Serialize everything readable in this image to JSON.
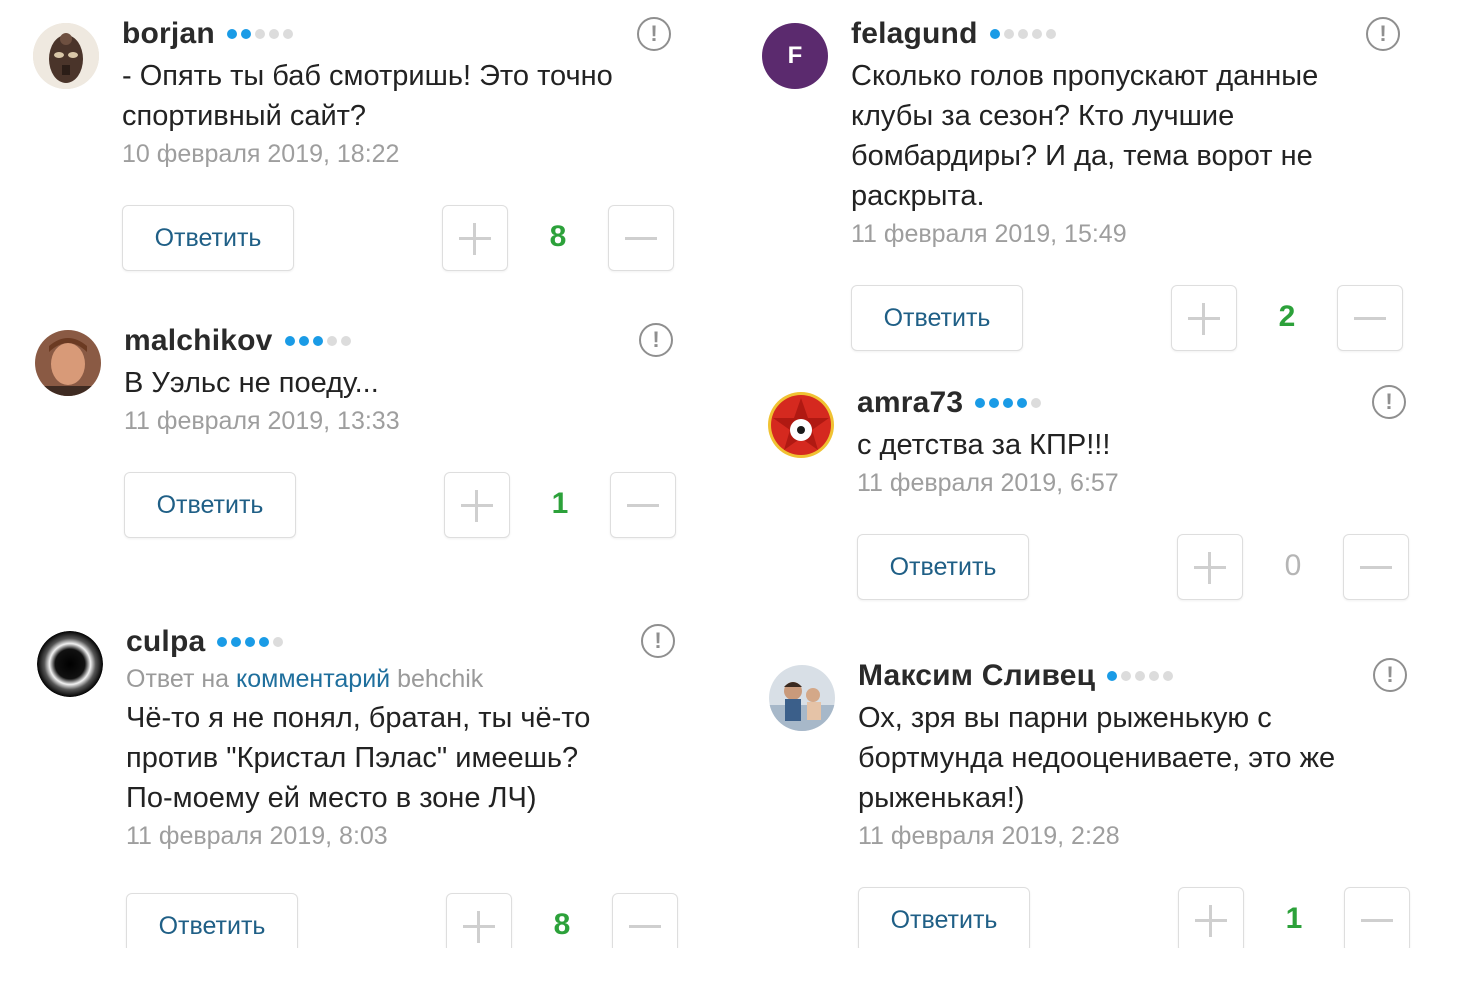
{
  "left": [
    {
      "username": "borjan",
      "rating_on": 2,
      "text_lines": [
        "- Опять ты баб смотришь! Это точно",
        "спортивный сайт?"
      ],
      "date": "10 февраля 2019, 18:22",
      "reply_label": "Ответить",
      "score": "8",
      "score_style": "pos",
      "report_symbol": "!"
    },
    {
      "username": "malchikov",
      "rating_on": 3,
      "text_lines": [
        "В Уэльс не поеду..."
      ],
      "date": "11 февраля 2019, 13:33",
      "reply_label": "Ответить",
      "score": "1",
      "score_style": "pos",
      "report_symbol": "!"
    },
    {
      "username": "culpa",
      "rating_on": 4,
      "reply_to": {
        "prefix": "Ответ на",
        "link": "комментарий",
        "user": "behchik"
      },
      "text_lines": [
        "Чё-то я не понял, братан, ты чё-то",
        "против \"Кристал Пэлас\" имеешь?",
        "По-моему ей место в зоне ЛЧ)"
      ],
      "date": "11 февраля 2019, 8:03",
      "reply_label": "Ответить",
      "score": "8",
      "score_style": "pos",
      "report_symbol": "!"
    }
  ],
  "right": [
    {
      "username": "felagund",
      "rating_on": 1,
      "avatar_letter": "F",
      "text_lines": [
        "Сколько голов пропускают данные",
        "клубы за сезон? Кто лучшие",
        "бомбардиры? И да, тема ворот не",
        "раскрыта."
      ],
      "date": "11 февраля 2019, 15:49",
      "reply_label": "Ответить",
      "score": "2",
      "score_style": "pos",
      "report_symbol": "!"
    },
    {
      "username": "amra73",
      "rating_on": 4,
      "text_lines": [
        "с детства за КПР!!!"
      ],
      "date": "11 февраля 2019, 6:57",
      "reply_label": "Ответить",
      "score": "0",
      "score_style": "zero",
      "report_symbol": "!"
    },
    {
      "username": "Максим Сливец",
      "rating_on": 1,
      "text_lines": [
        "Ох, зря вы парни рыженькую с",
        "бортмунда недооцениваете, это же",
        "рыженькая!)"
      ],
      "date": "11 февраля 2019, 2:28",
      "reply_label": "Ответить",
      "score": "1",
      "score_style": "pos",
      "report_symbol": "!"
    }
  ],
  "colors": {
    "rating_on": "#1a9be6",
    "rating_off": "#dcdcdc",
    "score_positive": "#2ca13a",
    "link": "#1f6f9d",
    "felagund_avatar": "#5b2a6e"
  },
  "icons": [
    "plus-icon",
    "minus-icon",
    "report-icon"
  ]
}
